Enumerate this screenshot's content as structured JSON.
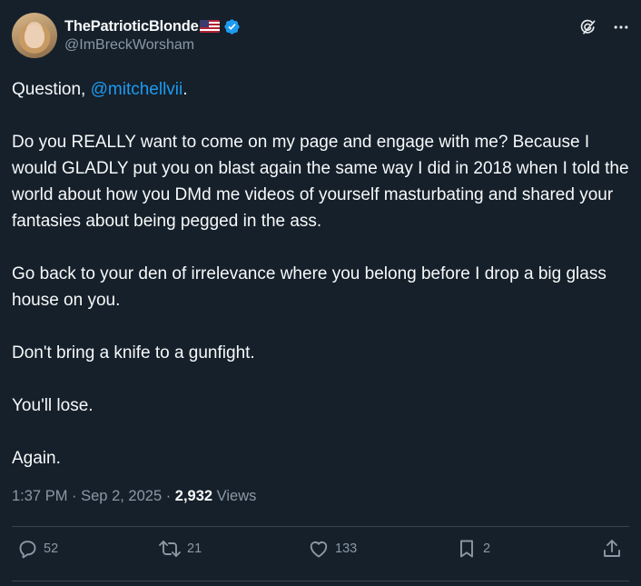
{
  "author": {
    "display_name": "ThePatrioticBlonde",
    "handle": "@ImBreckWorsham",
    "flag_icon": "us-flag-icon",
    "verified_color": "#1d9bf0"
  },
  "header_icons": [
    "grok-icon",
    "more-options-icon"
  ],
  "post": {
    "line1_prefix": "Question, ",
    "mention": "@mitchellvii",
    "line1_suffix": ".",
    "p2": "Do you REALLY want to come on my page and engage with me? Because I would GLADLY put you on blast again the same way I did in 2018 when I told the world about how you DMd me videos of yourself masturbating and shared your fantasies about being pegged in the ass.",
    "p3": "Go back to your den of irrelevance where you belong before I drop a big glass house on you.",
    "p4": "Don't bring a knife to a gunfight.",
    "p5": "You'll lose.",
    "p6": "Again."
  },
  "meta": {
    "time": "1:37 PM",
    "sep1": " · ",
    "date": "Sep 2, 2025",
    "sep2": " · ",
    "views_count": "2,932",
    "views_label": " Views"
  },
  "actions": {
    "replies": "52",
    "reposts": "21",
    "likes": "133",
    "bookmarks": "2"
  },
  "colors": {
    "background": "#15202b",
    "text": "#f7f9f9",
    "secondary": "#8b98a5",
    "accent": "#1d9bf0",
    "divider": "#38444d"
  }
}
